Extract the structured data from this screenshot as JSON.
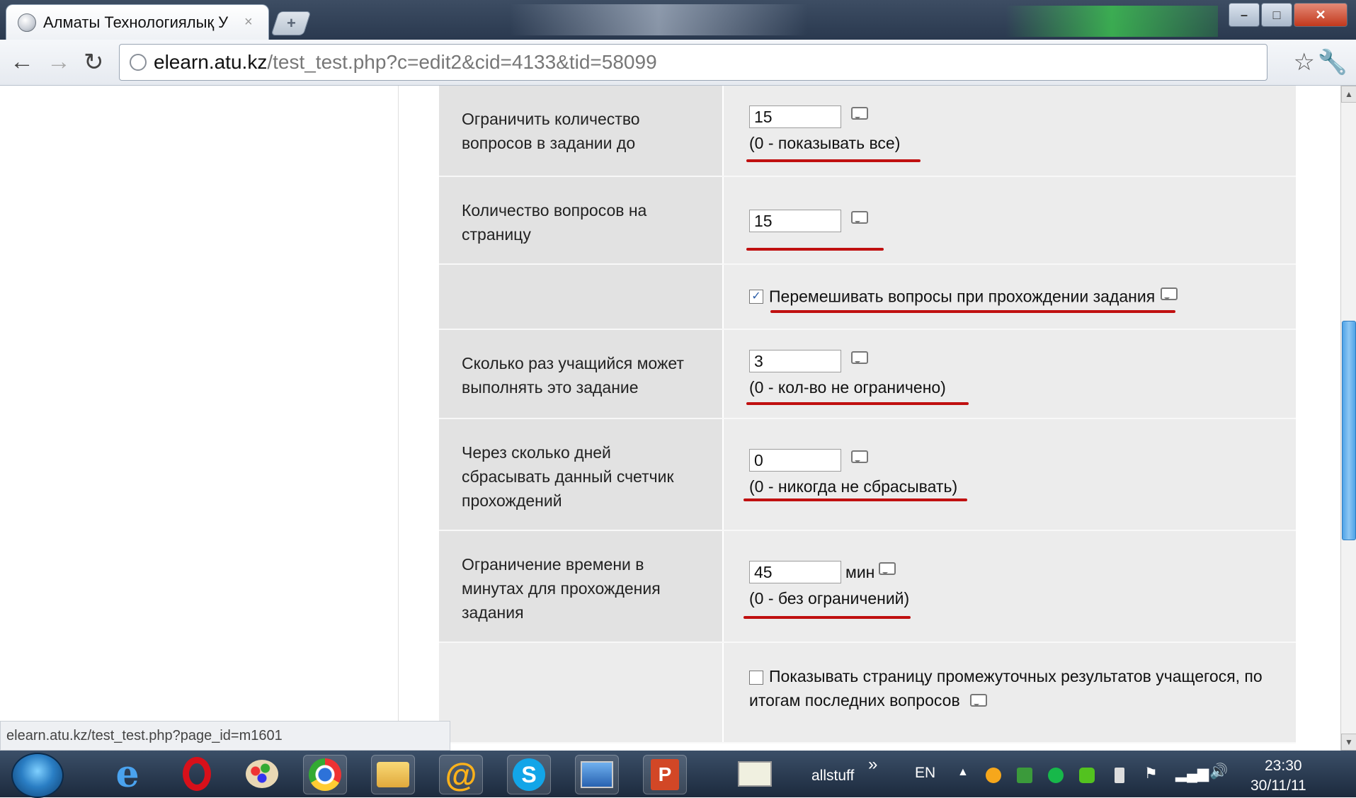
{
  "browser": {
    "tab_title": "Алматы Технологиялық У",
    "tab_close": "×",
    "new_tab": "+",
    "url_host": "elearn.atu.kz",
    "url_path": "/test_test.php?c=edit2&cid=4133&tid=58099",
    "window_buttons": [
      "–",
      "□",
      "✕"
    ]
  },
  "form": {
    "limit_questions": {
      "label": "Ограничить количество вопросов в задании до",
      "value": "15",
      "hint": "(0 - показывать все)"
    },
    "questions_per_page": {
      "label": "Количество вопросов на страницу",
      "value": "15"
    },
    "shuffle": {
      "label": "Перемешивать вопросы при прохождении задания",
      "checked": true
    },
    "attempts": {
      "label": "Сколько раз учащийся может выполнять это задание",
      "value": "3",
      "hint": "(0 - кол-во не ограничено)"
    },
    "reset_days": {
      "label": "Через сколько дней сбрасывать данный счетчик прохождений",
      "value": "0",
      "hint": "(0 - никогда не сбрасывать)"
    },
    "time_limit": {
      "label": "Ограничение времени в минутах для прохождения задания",
      "value": "45",
      "unit": "мин",
      "hint": "(0 - без ограничений)"
    },
    "show_intermediate": {
      "label": "Показывать страницу промежуточных результатов учащегося, по итогам последних вопросов",
      "checked": false
    }
  },
  "status_bar": {
    "url": "elearn.atu.kz/test_test.php?page_id=m1601"
  },
  "taskbar": {
    "allstuff": "allstuff",
    "chevron": "»",
    "lang": "EN",
    "time": "23:30",
    "date": "30/11/11"
  },
  "colors": {
    "underline": "#c01010",
    "label_bg": "#e2e2e2",
    "value_bg": "#ececec"
  },
  "icons": [
    "globe-icon",
    "back-arrow-icon",
    "forward-arrow-icon",
    "reload-icon",
    "star-icon",
    "wrench-icon",
    "comment-icon",
    "windows-start-icon",
    "ie-icon",
    "opera-icon",
    "paint-icon",
    "chrome-icon",
    "explorer-icon",
    "mail-agent-icon",
    "skype-icon",
    "network-icon",
    "powerpoint-icon",
    "pen-icon"
  ]
}
